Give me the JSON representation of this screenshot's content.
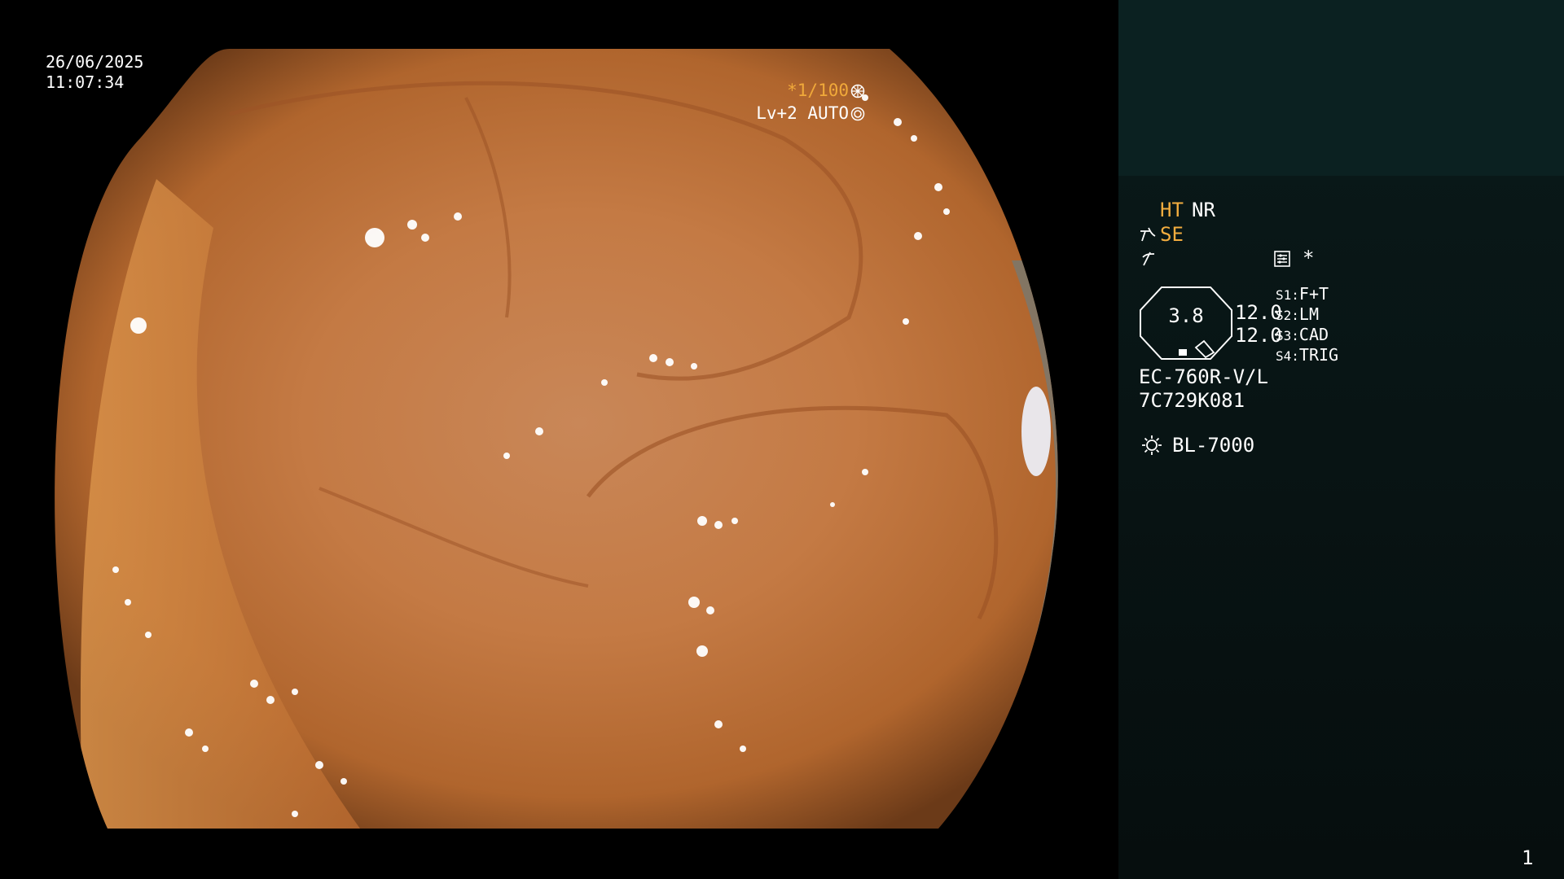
{
  "overlay": {
    "date": "26/06/2025",
    "time": "11:07:34",
    "shutter_prefix": "*1/100",
    "level": "Lv+2 AUTO"
  },
  "panel": {
    "ht": "HT",
    "nr": "NR",
    "se": "SE",
    "star": "*",
    "gauge_value": "3.8",
    "value_1": "12.0",
    "value_2": "12.0",
    "slots": [
      {
        "key": "S1:",
        "value": "F+T"
      },
      {
        "key": "S2:",
        "value": "LM"
      },
      {
        "key": "S3:",
        "value": "CAD"
      },
      {
        "key": "S4:",
        "value": "TRIG"
      }
    ],
    "scope_model": "EC-760R-V/L",
    "serial": "7C729K081",
    "light_source": "BL-7000",
    "page_number": "1"
  },
  "colors": {
    "accent_orange": "#f3ad3f",
    "panel_top": "#0b2121",
    "panel_bg": "#060e0e"
  },
  "icons": [
    "shutter-icon",
    "auto-icon",
    "se-icon",
    "filter-icon",
    "config-icon",
    "light-icon"
  ]
}
